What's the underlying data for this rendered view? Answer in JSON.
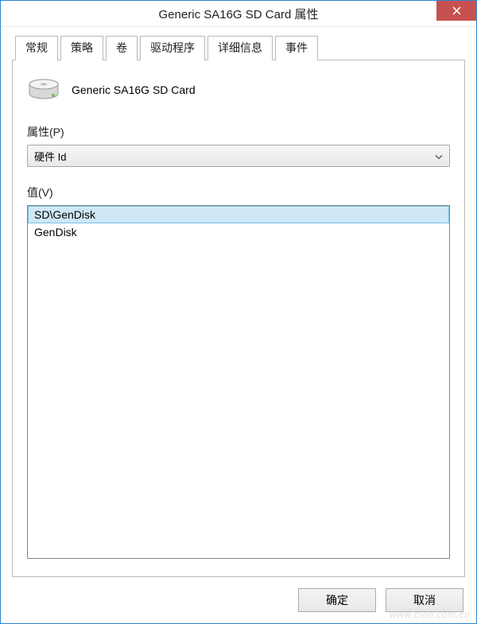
{
  "window": {
    "title": "Generic SA16G SD Card 属性"
  },
  "tabs": [
    {
      "label": "常规"
    },
    {
      "label": "策略"
    },
    {
      "label": "卷"
    },
    {
      "label": "驱动程序"
    },
    {
      "label": "详细信息",
      "active": true
    },
    {
      "label": "事件"
    }
  ],
  "device": {
    "name": "Generic SA16G SD Card"
  },
  "property": {
    "label": "属性(P)",
    "selected": "硬件 Id"
  },
  "value": {
    "label": "值(V)",
    "items": [
      {
        "text": "SD\\GenDisk",
        "selected": true
      },
      {
        "text": "GenDisk",
        "selected": false
      }
    ]
  },
  "buttons": {
    "ok": "确定",
    "cancel": "取消"
  },
  "watermark": "www.cfan.com.cn"
}
